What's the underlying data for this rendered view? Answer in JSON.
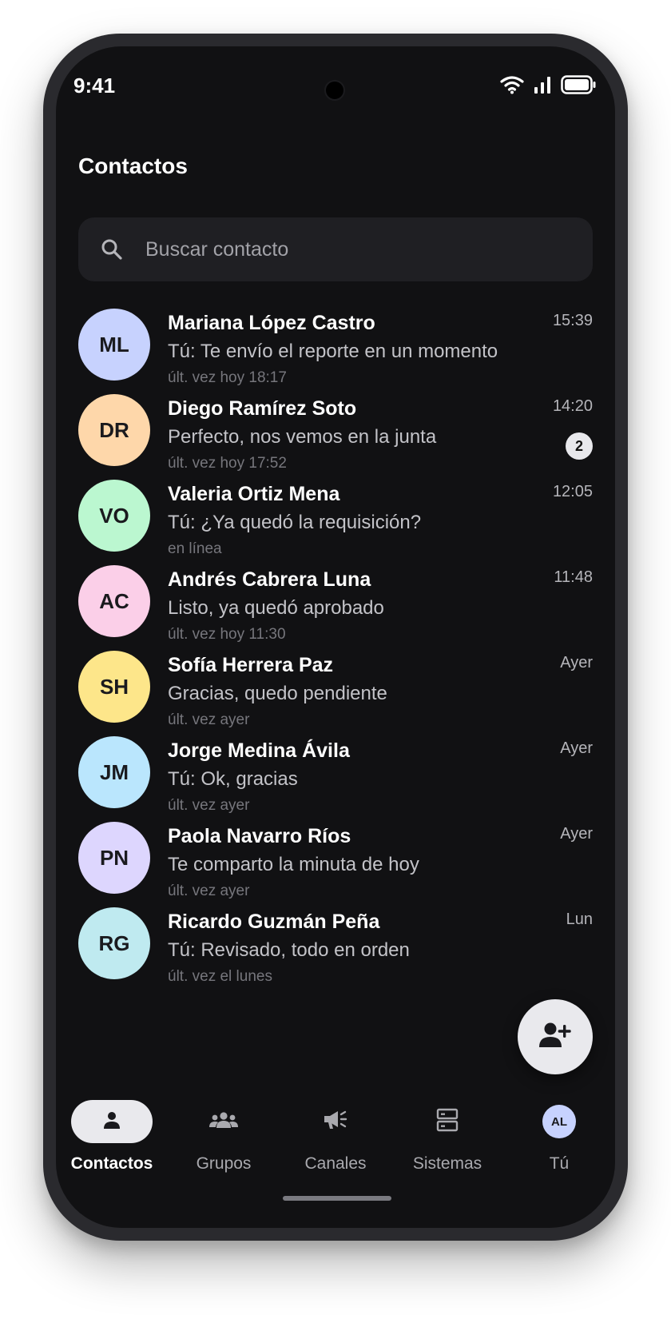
{
  "status": {
    "time": "9:41",
    "wifi_icon": "wifi-icon",
    "signal_icon": "signal-icon",
    "battery_icon": "battery-icon"
  },
  "header": {
    "title": "Contactos"
  },
  "search": {
    "placeholder": "Buscar contacto",
    "value": "",
    "icon": "search-icon"
  },
  "contacts": [
    {
      "initials": "ML",
      "name": "Mariana López Castro",
      "message": "Tú: Te envío el reporte en un momento",
      "seen": "últ. vez hoy 18:17",
      "time": "15:39",
      "badge": "",
      "color": "#c7d2fe"
    },
    {
      "initials": "DR",
      "name": "Diego Ramírez Soto",
      "message": "Perfecto, nos vemos en la junta",
      "seen": "últ. vez hoy 17:52",
      "time": "14:20",
      "badge": "2",
      "color": "#fed7aa"
    },
    {
      "initials": "VO",
      "name": "Valeria Ortiz Mena",
      "message": "Tú: ¿Ya quedó la requisición?",
      "seen": "en línea",
      "time": "12:05",
      "badge": "",
      "color": "#bbf7d0"
    },
    {
      "initials": "AC",
      "name": "Andrés Cabrera Luna",
      "message": "Listo, ya quedó aprobado",
      "seen": "últ. vez hoy 11:30",
      "time": "11:48",
      "badge": "",
      "color": "#fbcfe8"
    },
    {
      "initials": "SH",
      "name": "Sofía Herrera Paz",
      "message": "Gracias, quedo pendiente",
      "seen": "últ. vez ayer",
      "time": "Ayer",
      "badge": "",
      "color": "#fde68a"
    },
    {
      "initials": "JM",
      "name": "Jorge Medina Ávila",
      "message": "Tú: Ok, gracias",
      "seen": "últ. vez ayer",
      "time": "Ayer",
      "badge": "",
      "color": "#bae6fd"
    },
    {
      "initials": "PN",
      "name": "Paola Navarro Ríos",
      "message": "Te comparto la minuta de hoy",
      "seen": "últ. vez ayer",
      "time": "Ayer",
      "badge": "",
      "color": "#ddd6fe"
    },
    {
      "initials": "RG",
      "name": "Ricardo Guzmán Peña",
      "message": "Tú: Revisado, todo en orden",
      "seen": "últ. vez el lunes",
      "time": "Lun",
      "badge": "",
      "color": "#bfeaf0"
    }
  ],
  "fab": {
    "icon": "add-contact-icon"
  },
  "nav": {
    "items": [
      {
        "label": "Contactos",
        "icon": "person-icon",
        "active": true
      },
      {
        "label": "Grupos",
        "icon": "group-icon",
        "active": false
      },
      {
        "label": "Canales",
        "icon": "megaphone-icon",
        "active": false
      },
      {
        "label": "Sistemas",
        "icon": "server-icon",
        "active": false
      },
      {
        "label": "Tú",
        "icon": "profile-avatar",
        "active": false
      }
    ],
    "profile_initials": "AL"
  },
  "colors": {
    "background": "#111113",
    "surface": "#1f1f23",
    "accent": "#e9e9ed",
    "profile_avatar": "#c7d2fe"
  }
}
